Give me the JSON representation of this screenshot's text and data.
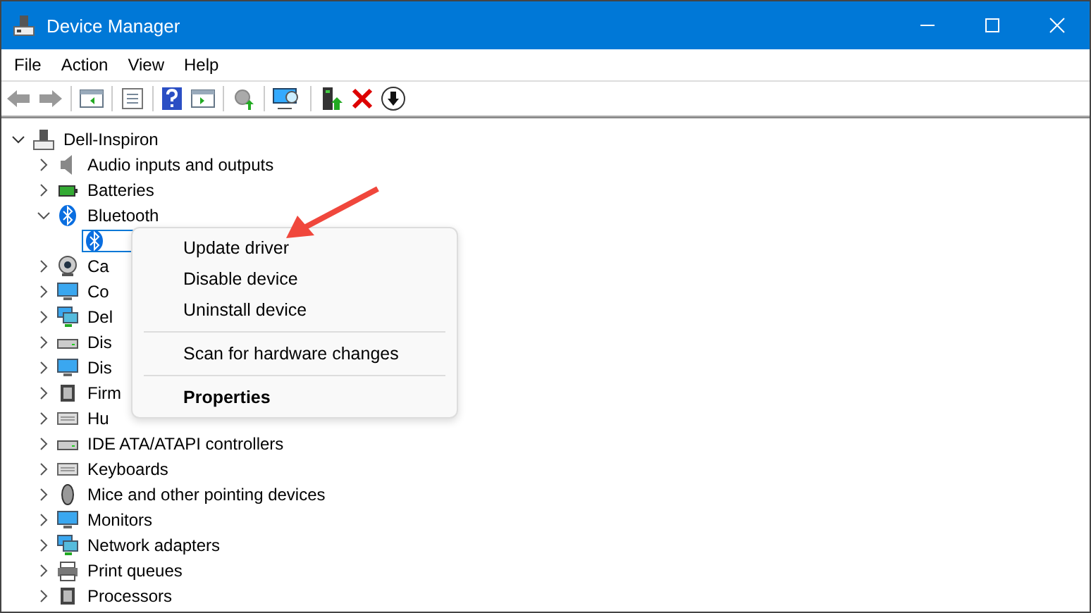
{
  "window": {
    "title": "Device Manager"
  },
  "menu": [
    "File",
    "Action",
    "View",
    "Help"
  ],
  "tree": {
    "label": "Dell-Inspiron",
    "expanded": true,
    "children": [
      {
        "label": "Audio inputs and outputs",
        "expanded": false,
        "selected": false
      },
      {
        "label": "Batteries",
        "expanded": false,
        "selected": false
      },
      {
        "label": "Bluetooth",
        "expanded": true,
        "selected": false,
        "children": [
          {
            "selected": true
          }
        ]
      },
      {
        "label": "Ca",
        "expanded": false,
        "selected": false
      },
      {
        "label": "Co",
        "expanded": false,
        "selected": false
      },
      {
        "label": "Del",
        "expanded": false,
        "selected": false
      },
      {
        "label": "Dis",
        "expanded": false,
        "selected": false
      },
      {
        "label": "Dis",
        "expanded": false,
        "selected": false
      },
      {
        "label": "Firm",
        "expanded": false,
        "selected": false
      },
      {
        "label": "Hu",
        "expanded": false,
        "selected": false
      },
      {
        "label": "IDE ATA/ATAPI controllers",
        "expanded": false,
        "selected": false
      },
      {
        "label": "Keyboards",
        "expanded": false,
        "selected": false
      },
      {
        "label": "Mice and other pointing devices",
        "expanded": false,
        "selected": false
      },
      {
        "label": "Monitors",
        "expanded": false,
        "selected": false
      },
      {
        "label": "Network adapters",
        "expanded": false,
        "selected": false
      },
      {
        "label": "Print queues",
        "expanded": false,
        "selected": false
      },
      {
        "label": "Processors",
        "expanded": false,
        "selected": false
      }
    ]
  },
  "context_menu": [
    {
      "kind": "item",
      "label": "Update driver",
      "bold": false
    },
    {
      "kind": "item",
      "label": "Disable device",
      "bold": false
    },
    {
      "kind": "item",
      "label": "Uninstall device",
      "bold": false
    },
    {
      "kind": "separator"
    },
    {
      "kind": "item",
      "label": "Scan for hardware changes",
      "bold": false
    },
    {
      "kind": "separator"
    },
    {
      "kind": "item",
      "label": "Properties",
      "bold": true
    }
  ]
}
